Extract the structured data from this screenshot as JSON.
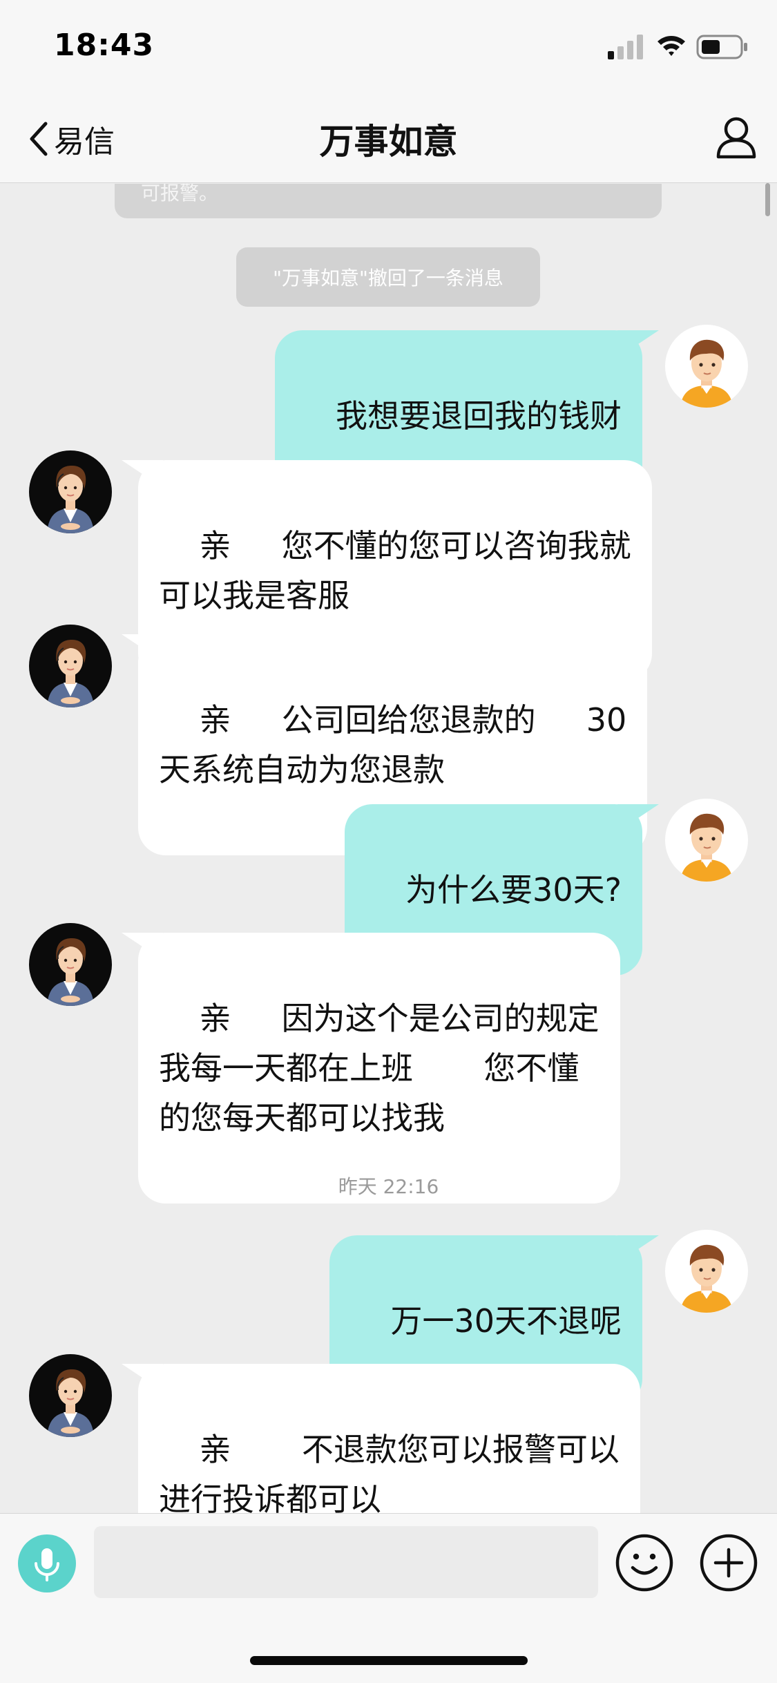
{
  "status_bar": {
    "time": "18:43"
  },
  "nav": {
    "back_label": "易信",
    "title": "万事如意"
  },
  "chat": {
    "cut_off_text": "可报警。",
    "system_notice": "\"万事如意\"撤回了一条消息",
    "timestamp": "昨天 22:16",
    "messages": [
      {
        "from": "user",
        "text": "我想要退回我的钱财"
      },
      {
        "from": "agent",
        "text": "亲     您不懂的您可以咨询我就\n可以我是客服"
      },
      {
        "from": "agent",
        "text": "亲     公司回给您退款的     30\n天系统自动为您退款"
      },
      {
        "from": "user",
        "text": "为什么要30天?"
      },
      {
        "from": "agent",
        "text": "亲     因为这个是公司的规定\n我每一天都在上班       您不懂\n的您每天都可以找我"
      },
      {
        "from": "user",
        "text": "万一30天不退呢"
      },
      {
        "from": "agent",
        "text": "亲       不退款您可以报警可以\n进行投诉都可以"
      }
    ]
  },
  "icons": {
    "back": "chevron-left-icon",
    "profile": "person-icon",
    "mic": "microphone-icon",
    "emoji": "smiley-icon",
    "plus": "plus-circle-icon"
  },
  "colors": {
    "outgoing_bubble": "#aaeee9",
    "incoming_bubble": "#ffffff",
    "accent": "#5bd3cb",
    "background": "#ededed"
  }
}
